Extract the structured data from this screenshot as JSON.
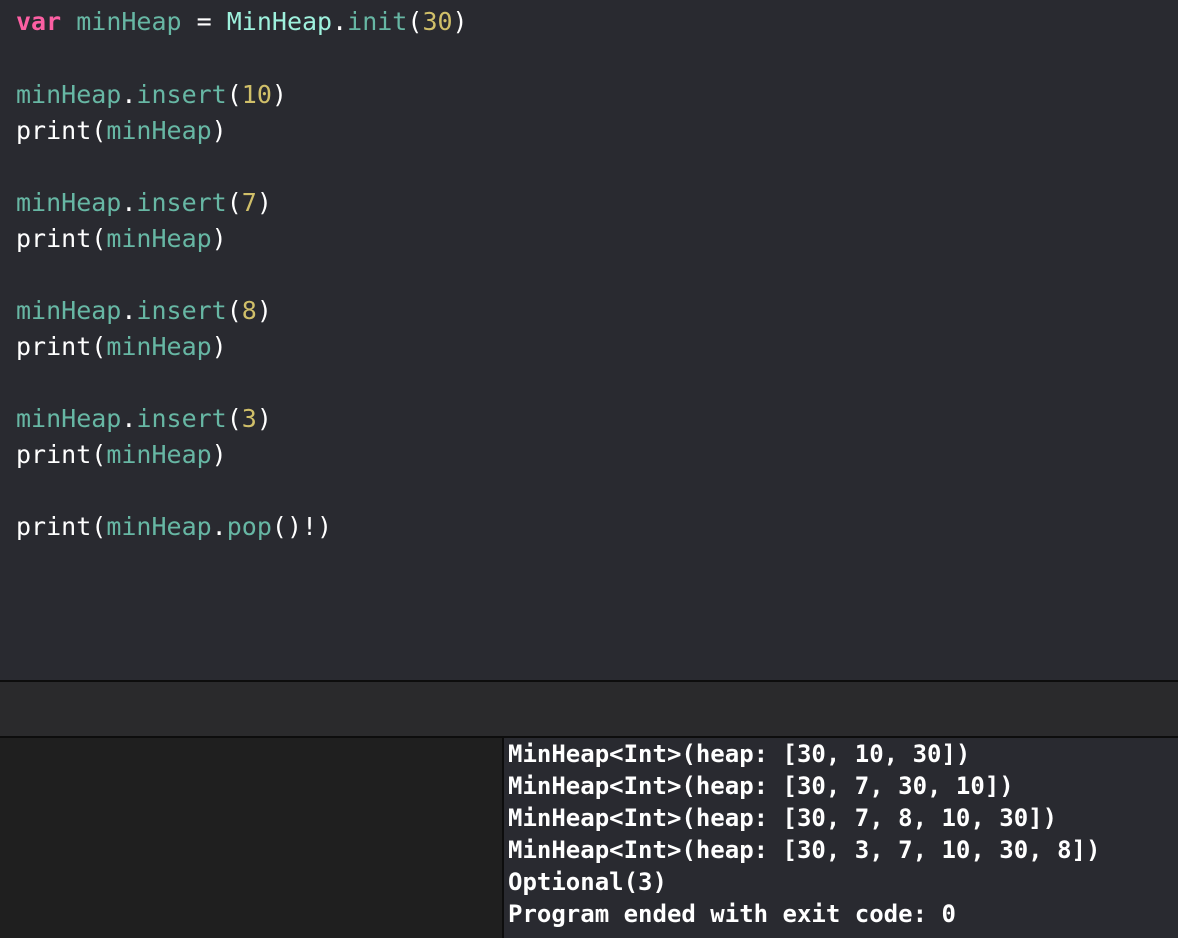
{
  "colors": {
    "editor_background": "#292a30",
    "keyword": "#fc5fa3",
    "declaration": "#67b7a4",
    "type": "#9ef1dd",
    "method": "#67b7a4",
    "number": "#d0bf69",
    "plain_text": "#ffffff",
    "console_background": "#292a30",
    "variables_background": "#1f1f1f"
  },
  "editor": {
    "lines": [
      {
        "tokens": [
          {
            "kind": "keyword",
            "text": "var"
          },
          {
            "kind": "plain",
            "text": " "
          },
          {
            "kind": "decl",
            "text": "minHeap"
          },
          {
            "kind": "plain",
            "text": " = "
          },
          {
            "kind": "type",
            "text": "MinHeap"
          },
          {
            "kind": "plain",
            "text": "."
          },
          {
            "kind": "method",
            "text": "init"
          },
          {
            "kind": "plain",
            "text": "("
          },
          {
            "kind": "number",
            "text": "30"
          },
          {
            "kind": "plain",
            "text": ")"
          }
        ]
      },
      {
        "tokens": [
          {
            "kind": "var",
            "text": "minHeap"
          },
          {
            "kind": "plain",
            "text": "."
          },
          {
            "kind": "method",
            "text": "insert"
          },
          {
            "kind": "plain",
            "text": "("
          },
          {
            "kind": "number",
            "text": "10"
          },
          {
            "kind": "plain",
            "text": ")"
          }
        ]
      },
      {
        "tokens": [
          {
            "kind": "plain",
            "text": "print("
          },
          {
            "kind": "var",
            "text": "minHeap"
          },
          {
            "kind": "plain",
            "text": ")"
          }
        ]
      },
      {
        "tokens": [
          {
            "kind": "var",
            "text": "minHeap"
          },
          {
            "kind": "plain",
            "text": "."
          },
          {
            "kind": "method",
            "text": "insert"
          },
          {
            "kind": "plain",
            "text": "("
          },
          {
            "kind": "number",
            "text": "7"
          },
          {
            "kind": "plain",
            "text": ")"
          }
        ]
      },
      {
        "tokens": [
          {
            "kind": "plain",
            "text": "print("
          },
          {
            "kind": "var",
            "text": "minHeap"
          },
          {
            "kind": "plain",
            "text": ")"
          }
        ]
      },
      {
        "tokens": [
          {
            "kind": "var",
            "text": "minHeap"
          },
          {
            "kind": "plain",
            "text": "."
          },
          {
            "kind": "method",
            "text": "insert"
          },
          {
            "kind": "plain",
            "text": "("
          },
          {
            "kind": "number",
            "text": "8"
          },
          {
            "kind": "plain",
            "text": ")"
          }
        ]
      },
      {
        "tokens": [
          {
            "kind": "plain",
            "text": "print("
          },
          {
            "kind": "var",
            "text": "minHeap"
          },
          {
            "kind": "plain",
            "text": ")"
          }
        ]
      },
      {
        "tokens": [
          {
            "kind": "var",
            "text": "minHeap"
          },
          {
            "kind": "plain",
            "text": "."
          },
          {
            "kind": "method",
            "text": "insert"
          },
          {
            "kind": "plain",
            "text": "("
          },
          {
            "kind": "number",
            "text": "3"
          },
          {
            "kind": "plain",
            "text": ")"
          }
        ]
      },
      {
        "tokens": [
          {
            "kind": "plain",
            "text": "print("
          },
          {
            "kind": "var",
            "text": "minHeap"
          },
          {
            "kind": "plain",
            "text": ")"
          }
        ]
      },
      {
        "tokens": [
          {
            "kind": "plain",
            "text": "print("
          },
          {
            "kind": "var",
            "text": "minHeap"
          },
          {
            "kind": "plain",
            "text": "."
          },
          {
            "kind": "method",
            "text": "pop"
          },
          {
            "kind": "plain",
            "text": "()!)"
          }
        ]
      }
    ]
  },
  "console": {
    "lines": [
      "MinHeap<Int>(heap: [30, 10, 30])",
      "MinHeap<Int>(heap: [30, 7, 30, 10])",
      "MinHeap<Int>(heap: [30, 7, 8, 10, 30])",
      "MinHeap<Int>(heap: [30, 3, 7, 10, 30, 8])",
      "Optional(3)",
      "Program ended with exit code: 0"
    ]
  }
}
